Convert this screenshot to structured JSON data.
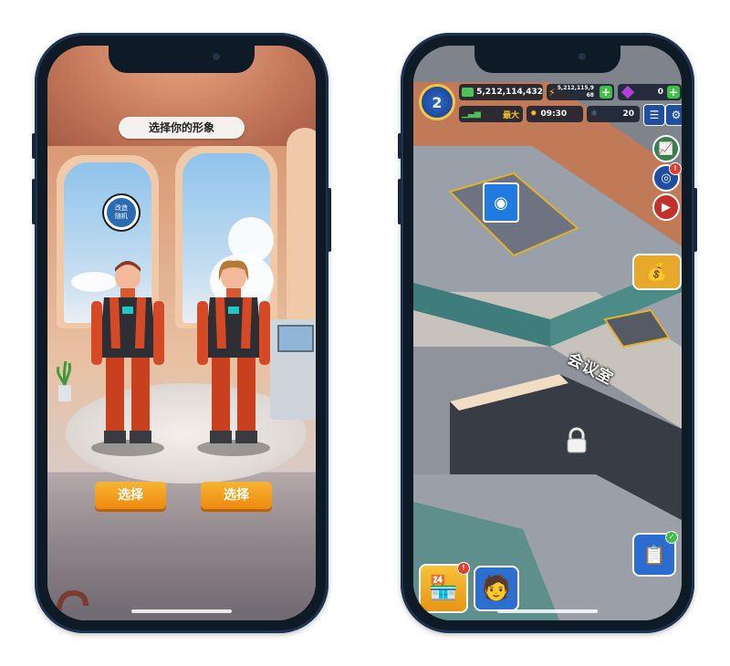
{
  "left_phone": {
    "title": "选择你的形象",
    "random_button": "改造\n随机",
    "characters": [
      {
        "name": "male",
        "select_label": "选择"
      },
      {
        "name": "female",
        "select_label": "选择"
      }
    ]
  },
  "right_phone": {
    "level": "2",
    "cash": "5,212,114,432",
    "energy": "5,212,115,9",
    "energy_sub": "68",
    "gems": "0",
    "max_label": "最大",
    "timer": "09:30",
    "population": "20",
    "room_label": "会议室"
  },
  "colors": {
    "select_button": "#f29a1a",
    "hud_plus": "#3fbf4a",
    "badge": "#e43b2c"
  }
}
